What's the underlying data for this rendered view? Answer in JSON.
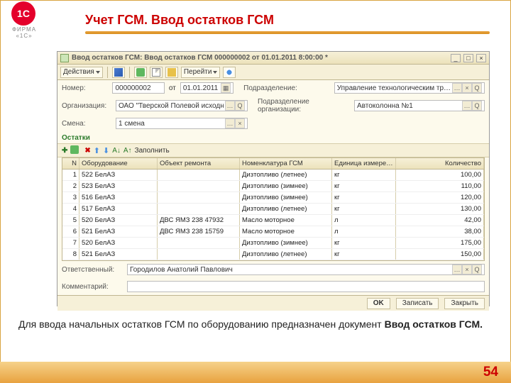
{
  "slide": {
    "logo_abbr": "1С",
    "logo_sub": "ФИРМА «1С»",
    "title": "Учет ГСМ. Ввод остатков ГСМ",
    "caption_pre": "Для ввода начальных остатков ГСМ по оборудованию предназначен документ ",
    "caption_bold": "Ввод остатков ГСМ.",
    "page": "54"
  },
  "window": {
    "title": "Ввод остатков ГСМ: Ввод остатков ГСМ 000000002 от 01.01.2011 8:00:00 *",
    "toolbar": {
      "actions": "Действия",
      "goto": "Перейти"
    },
    "form": {
      "number_label": "Номер:",
      "number": "000000002",
      "from": "от",
      "date": "01.01.2011",
      "division_label": "Подразделение:",
      "division": "Управление технологическим тр…",
      "org_label": "Организация:",
      "org": "ОАО \"Тверской Полевой  исходный\"",
      "org_div_label": "Подразделение организации:",
      "org_div": "Автоколонна №1",
      "shift_label": "Смена:",
      "shift": "1 смена"
    },
    "section": "Остатки",
    "table_toolbar": {
      "fill": "Заполнить"
    },
    "columns": {
      "n": "N",
      "eq": "Оборудование",
      "obj": "Объект ремонта",
      "nom": "Номенклатура ГСМ",
      "unit": "Единица измере…",
      "qty": "Количество"
    },
    "rows": [
      {
        "n": "1",
        "eq": "522 БелАЗ",
        "obj": "",
        "nom": "Дизтопливо (летнее)",
        "unit": "кг",
        "qty": "100,00"
      },
      {
        "n": "2",
        "eq": "523 БелАЗ",
        "obj": "",
        "nom": "Дизтопливо (зимнее)",
        "unit": "кг",
        "qty": "110,00"
      },
      {
        "n": "3",
        "eq": "516 БелАЗ",
        "obj": "",
        "nom": "Дизтопливо (зимнее)",
        "unit": "кг",
        "qty": "120,00"
      },
      {
        "n": "4",
        "eq": "517 БелАЗ",
        "obj": "",
        "nom": "Дизтопливо (летнее)",
        "unit": "кг",
        "qty": "130,00"
      },
      {
        "n": "5",
        "eq": "520 БелАЗ",
        "obj": "ДВС ЯМЗ 238 47932",
        "nom": "Масло моторное",
        "unit": "л",
        "qty": "42,00"
      },
      {
        "n": "6",
        "eq": "521 БелАЗ",
        "obj": "ДВС ЯМЗ 238 15759",
        "nom": "Масло моторное",
        "unit": "л",
        "qty": "38,00"
      },
      {
        "n": "7",
        "eq": "520 БелАЗ",
        "obj": "",
        "nom": "Дизтопливо (зимнее)",
        "unit": "кг",
        "qty": "175,00"
      },
      {
        "n": "8",
        "eq": "521 БелАЗ",
        "obj": "",
        "nom": "Дизтопливо (летнее)",
        "unit": "кг",
        "qty": "150,00"
      }
    ],
    "resp_label": "Ответственный:",
    "resp": "Городилов Анатолий Павлович",
    "comment_label": "Комментарий:",
    "comment": "",
    "footer": {
      "ok": "OK",
      "save": "Записать",
      "close": "Закрыть"
    }
  }
}
